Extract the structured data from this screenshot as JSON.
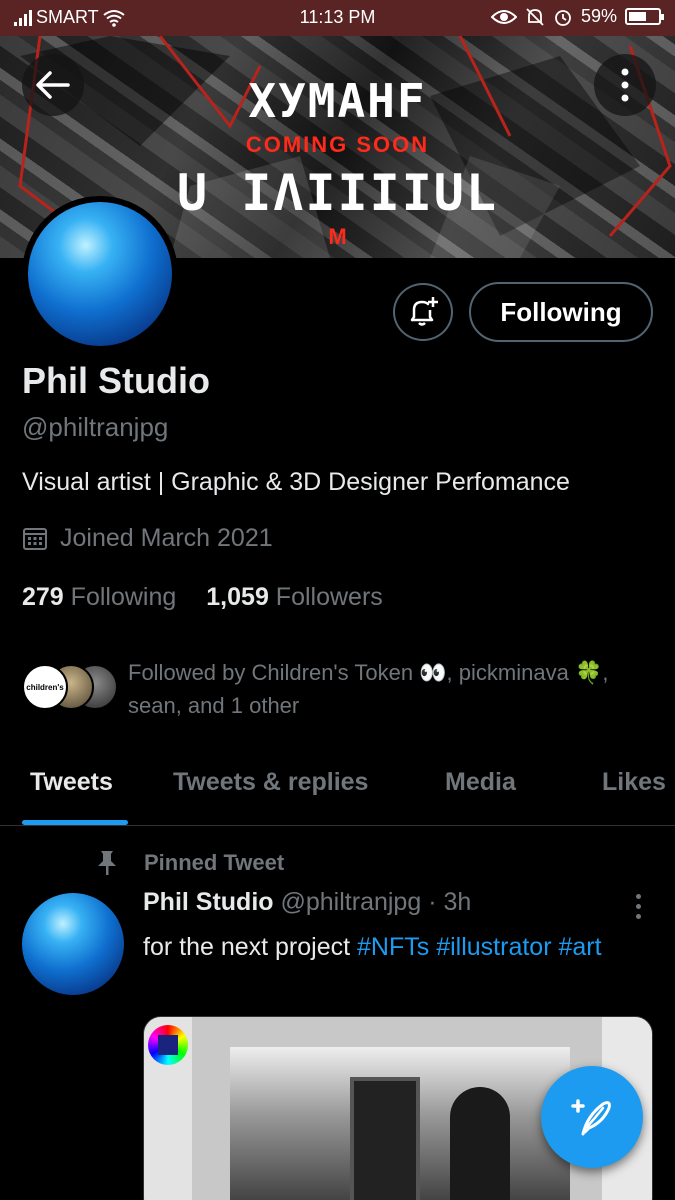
{
  "status_bar": {
    "carrier": "SMART",
    "time": "11:13 PM",
    "battery": "59%",
    "battery_level": 0.59,
    "icons": [
      "signal-bars-icon",
      "wifi-icon",
      "eye-icon",
      "silent-bell-icon",
      "alarm-icon",
      "battery-icon"
    ]
  },
  "banner": {
    "logo_line1": "ХУМАНF",
    "coming_soon": "COMING SOON",
    "logo_line2": "U ΙΛΙΙΙΙUL",
    "mark": "M",
    "colors": {
      "accent": "#ff2a1a"
    }
  },
  "profile": {
    "name": "Phil Studio",
    "handle": "@philtranjpg",
    "bio": "Visual artist | Graphic & 3D Designer Perfomance",
    "joined": "Joined March 2021",
    "following_count": "279",
    "following_label": "Following",
    "followers_count": "1,059",
    "followers_label": "Followers",
    "follow_button": "Following",
    "followed_by": "Followed by Children's Token 👀, pickminava 🍀, sean, and 1 other",
    "followed_avatar_label": "children's"
  },
  "tabs": [
    "Tweets",
    "Tweets & replies",
    "Media",
    "Likes"
  ],
  "active_tab": "Tweets",
  "tweet": {
    "pinned_label": "Pinned Tweet",
    "author": "Phil Studio",
    "handle": "@philtranjpg",
    "dot": "·",
    "time": "3h",
    "text": "for the next project",
    "hashtags": [
      "#NFTs",
      "#illustrator",
      "#art"
    ]
  },
  "colors": {
    "background": "#000000",
    "status_bar": "#5b2424",
    "accent": "#1d9bf0",
    "muted_text": "#71767b",
    "primary_text": "#e7e9ea",
    "border": "#536471"
  },
  "fab": {
    "icon": "compose-tweet-icon",
    "label": "+"
  }
}
